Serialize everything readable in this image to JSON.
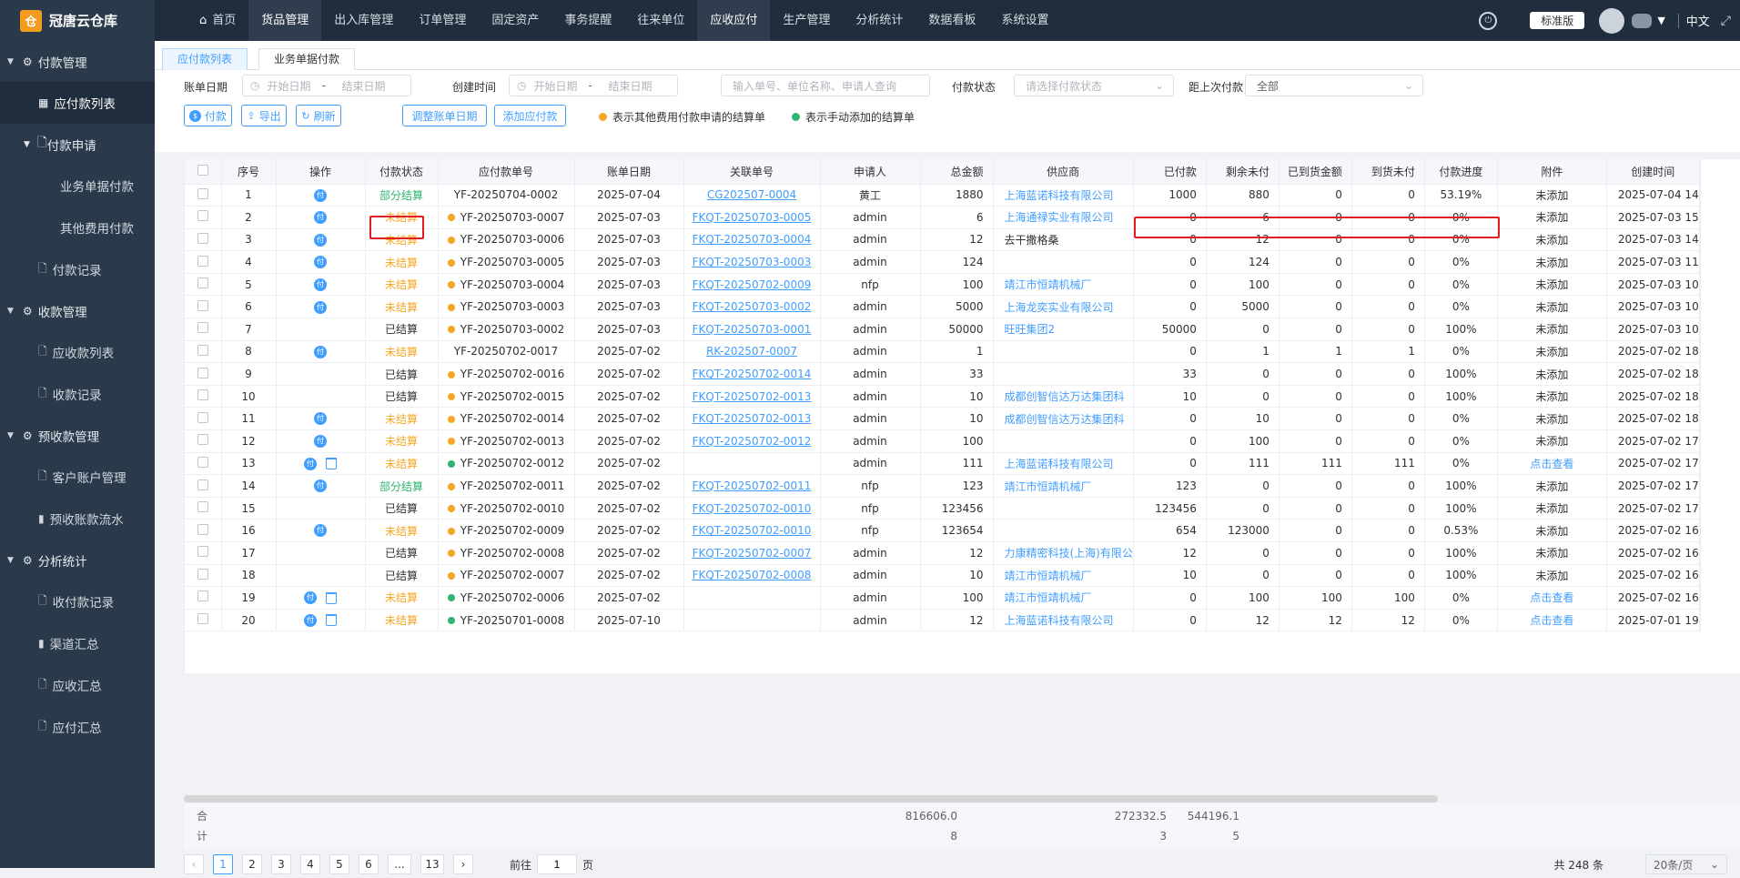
{
  "app": {
    "name": "冠唐云仓库",
    "logo_glyph": "仓"
  },
  "nav": [
    "首页",
    "货品管理",
    "出入库管理",
    "订单管理",
    "固定资产",
    "事务提醒",
    "往来单位",
    "应收应付",
    "生产管理",
    "分析统计",
    "数据看板",
    "系统设置"
  ],
  "topright": {
    "edition": "标准版",
    "lang": "中文"
  },
  "sidebar": {
    "g_pay": "付款管理",
    "payable_list": "应付款列表",
    "pay_request": "付款申请",
    "biz_pay": "业务单据付款",
    "other_pay": "其他费用付款",
    "pay_record": "付款记录",
    "g_receive": "收款管理",
    "receivable_list": "应收款列表",
    "receive_record": "收款记录",
    "g_prepay": "预收款管理",
    "cust_account": "客户账户管理",
    "prepay_flow": "预收账款流水",
    "g_analysis": "分析统计",
    "pay_receive_record": "收付款记录",
    "channel_sum": "渠道汇总",
    "receivable_sum": "应收汇总",
    "payable_sum": "应付汇总"
  },
  "tabs": [
    "应付款列表",
    "业务单据付款"
  ],
  "filters": {
    "bill_date": "账单日期",
    "create_time": "创建时间",
    "start_ph": "开始日期",
    "end_ph": "结束日期",
    "dash": "-",
    "search_ph": "输入单号、单位名称、申请人查询",
    "pay_status": "付款状态",
    "pay_status_ph": "请选择付款状态",
    "since_last": "距上次付款",
    "since_last_val": "全部"
  },
  "buttons": {
    "pay": "付款",
    "export": "导出",
    "refresh": "刷新",
    "adjust": "调整账单日期",
    "add": "添加应付款"
  },
  "legend": {
    "orange_text": "表示其他费用付款申请的结算单",
    "green_text": "表示手动添加的结算单",
    "orange": "#f5a623",
    "green": "#2fb56f"
  },
  "table": {
    "headers": [
      "序号",
      "操作",
      "付款状态",
      "应付款单号",
      "账单日期",
      "关联单号",
      "申请人",
      "总金额",
      "供应商",
      "已付款",
      "剩余未付",
      "已到货金额",
      "到货未付",
      "付款进度",
      "附件",
      "创建时间"
    ],
    "rows": [
      {
        "no": "1",
        "pay": true,
        "del": false,
        "status": "部分结算",
        "st": "part",
        "dot": "",
        "id": "YF-20250704-0002",
        "date": "2025-07-04",
        "ref": "CG202507-0004",
        "applicant": "黄工",
        "total": "1880",
        "supplier": "上海蓝诺科技有限公司",
        "paid": "1000",
        "remain": "880",
        "arrived": "0",
        "arr_unpaid": "0",
        "progress": "53.19%",
        "attach": "未添加",
        "attach_link": false,
        "created": "2025-07-04 14"
      },
      {
        "no": "2",
        "pay": true,
        "del": false,
        "status": "未结算",
        "st": "un",
        "dot": "orange",
        "id": "YF-20250703-0007",
        "date": "2025-07-03",
        "ref": "FKQT-20250703-0005",
        "applicant": "admin",
        "total": "6",
        "supplier": "上海通禄实业有限公司",
        "paid": "0",
        "remain": "6",
        "arrived": "0",
        "arr_unpaid": "0",
        "progress": "0%",
        "attach": "未添加",
        "attach_link": false,
        "created": "2025-07-03 15"
      },
      {
        "no": "3",
        "pay": true,
        "del": false,
        "status": "未结算",
        "st": "un",
        "dot": "orange",
        "id": "YF-20250703-0006",
        "date": "2025-07-03",
        "ref": "FKQT-20250703-0004",
        "applicant": "admin",
        "total": "12",
        "supplier": "去干撒格桑",
        "supplier_plain": true,
        "paid": "0",
        "remain": "12",
        "arrived": "0",
        "arr_unpaid": "0",
        "progress": "0%",
        "attach": "未添加",
        "attach_link": false,
        "created": "2025-07-03 14"
      },
      {
        "no": "4",
        "pay": true,
        "del": false,
        "status": "未结算",
        "st": "un",
        "dot": "orange",
        "id": "YF-20250703-0005",
        "date": "2025-07-03",
        "ref": "FKQT-20250703-0003",
        "applicant": "admin",
        "total": "124",
        "supplier": "",
        "paid": "0",
        "remain": "124",
        "arrived": "0",
        "arr_unpaid": "0",
        "progress": "0%",
        "attach": "未添加",
        "attach_link": false,
        "created": "2025-07-03 11"
      },
      {
        "no": "5",
        "pay": true,
        "del": false,
        "status": "未结算",
        "st": "un",
        "dot": "orange",
        "id": "YF-20250703-0004",
        "date": "2025-07-03",
        "ref": "FKQT-20250702-0009",
        "applicant": "nfp",
        "total": "100",
        "supplier": "靖江市恒靖机械厂",
        "paid": "0",
        "remain": "100",
        "arrived": "0",
        "arr_unpaid": "0",
        "progress": "0%",
        "attach": "未添加",
        "attach_link": false,
        "created": "2025-07-03 10"
      },
      {
        "no": "6",
        "pay": true,
        "del": false,
        "status": "未结算",
        "st": "un",
        "dot": "orange",
        "id": "YF-20250703-0003",
        "date": "2025-07-03",
        "ref": "FKQT-20250703-0002",
        "applicant": "admin",
        "total": "5000",
        "supplier": "上海龙奕实业有限公司",
        "paid": "0",
        "remain": "5000",
        "arrived": "0",
        "arr_unpaid": "0",
        "progress": "0%",
        "attach": "未添加",
        "attach_link": false,
        "created": "2025-07-03 10"
      },
      {
        "no": "7",
        "pay": false,
        "del": false,
        "status": "已结算",
        "st": "done",
        "dot": "orange",
        "id": "YF-20250703-0002",
        "date": "2025-07-03",
        "ref": "FKQT-20250703-0001",
        "applicant": "admin",
        "total": "50000",
        "supplier": "旺旺集团2",
        "paid": "50000",
        "remain": "0",
        "arrived": "0",
        "arr_unpaid": "0",
        "progress": "100%",
        "attach": "未添加",
        "attach_link": false,
        "created": "2025-07-03 10"
      },
      {
        "no": "8",
        "pay": true,
        "del": false,
        "status": "未结算",
        "st": "un",
        "dot": "",
        "id": "YF-20250702-0017",
        "date": "2025-07-02",
        "ref": "RK-202507-0007",
        "applicant": "admin",
        "total": "1",
        "supplier": "",
        "paid": "0",
        "remain": "1",
        "arrived": "1",
        "arr_unpaid": "1",
        "progress": "0%",
        "attach": "未添加",
        "attach_link": false,
        "created": "2025-07-02 18"
      },
      {
        "no": "9",
        "pay": false,
        "del": false,
        "status": "已结算",
        "st": "done",
        "dot": "orange",
        "id": "YF-20250702-0016",
        "date": "2025-07-02",
        "ref": "FKQT-20250702-0014",
        "applicant": "admin",
        "total": "33",
        "supplier": "",
        "paid": "33",
        "remain": "0",
        "arrived": "0",
        "arr_unpaid": "0",
        "progress": "100%",
        "attach": "未添加",
        "attach_link": false,
        "created": "2025-07-02 18"
      },
      {
        "no": "10",
        "pay": false,
        "del": false,
        "status": "已结算",
        "st": "done",
        "dot": "orange",
        "id": "YF-20250702-0015",
        "date": "2025-07-02",
        "ref": "FKQT-20250702-0013",
        "applicant": "admin",
        "total": "10",
        "supplier": "成都创智信达万达集团科",
        "paid": "10",
        "remain": "0",
        "arrived": "0",
        "arr_unpaid": "0",
        "progress": "100%",
        "attach": "未添加",
        "attach_link": false,
        "created": "2025-07-02 18"
      },
      {
        "no": "11",
        "pay": true,
        "del": false,
        "status": "未结算",
        "st": "un",
        "dot": "orange",
        "id": "YF-20250702-0014",
        "date": "2025-07-02",
        "ref": "FKQT-20250702-0013",
        "applicant": "admin",
        "total": "10",
        "supplier": "成都创智信达万达集团科",
        "paid": "0",
        "remain": "10",
        "arrived": "0",
        "arr_unpaid": "0",
        "progress": "0%",
        "attach": "未添加",
        "attach_link": false,
        "created": "2025-07-02 18"
      },
      {
        "no": "12",
        "pay": true,
        "del": false,
        "status": "未结算",
        "st": "un",
        "dot": "orange",
        "id": "YF-20250702-0013",
        "date": "2025-07-02",
        "ref": "FKQT-20250702-0012",
        "applicant": "admin",
        "total": "100",
        "supplier": "",
        "paid": "0",
        "remain": "100",
        "arrived": "0",
        "arr_unpaid": "0",
        "progress": "0%",
        "attach": "未添加",
        "attach_link": false,
        "created": "2025-07-02 17"
      },
      {
        "no": "13",
        "pay": true,
        "del": true,
        "status": "未结算",
        "st": "un",
        "dot": "green",
        "id": "YF-20250702-0012",
        "date": "2025-07-02",
        "ref": "",
        "applicant": "admin",
        "total": "111",
        "supplier": "上海蓝诺科技有限公司",
        "paid": "0",
        "remain": "111",
        "arrived": "111",
        "arr_unpaid": "111",
        "progress": "0%",
        "attach": "点击查看",
        "attach_link": true,
        "created": "2025-07-02 17"
      },
      {
        "no": "14",
        "pay": true,
        "del": false,
        "status": "部分结算",
        "st": "part",
        "dot": "orange",
        "id": "YF-20250702-0011",
        "date": "2025-07-02",
        "ref": "FKQT-20250702-0011",
        "applicant": "nfp",
        "total": "123",
        "supplier": "靖江市恒靖机械厂",
        "paid": "123",
        "remain": "0",
        "arrived": "0",
        "arr_unpaid": "0",
        "progress": "100%",
        "attach": "未添加",
        "attach_link": false,
        "created": "2025-07-02 17"
      },
      {
        "no": "15",
        "pay": false,
        "del": false,
        "status": "已结算",
        "st": "done",
        "dot": "orange",
        "id": "YF-20250702-0010",
        "date": "2025-07-02",
        "ref": "FKQT-20250702-0010",
        "applicant": "nfp",
        "total": "123456",
        "supplier": "",
        "paid": "123456",
        "remain": "0",
        "arrived": "0",
        "arr_unpaid": "0",
        "progress": "100%",
        "attach": "未添加",
        "attach_link": false,
        "created": "2025-07-02 17"
      },
      {
        "no": "16",
        "pay": true,
        "del": false,
        "status": "未结算",
        "st": "un",
        "dot": "orange",
        "id": "YF-20250702-0009",
        "date": "2025-07-02",
        "ref": "FKQT-20250702-0010",
        "applicant": "nfp",
        "total": "123654",
        "supplier": "",
        "paid": "654",
        "remain": "123000",
        "arrived": "0",
        "arr_unpaid": "0",
        "progress": "0.53%",
        "attach": "未添加",
        "attach_link": false,
        "created": "2025-07-02 16"
      },
      {
        "no": "17",
        "pay": false,
        "del": false,
        "status": "已结算",
        "st": "done",
        "dot": "orange",
        "id": "YF-20250702-0008",
        "date": "2025-07-02",
        "ref": "FKQT-20250702-0007",
        "applicant": "admin",
        "total": "12",
        "supplier": "力康精密科技(上海)有限公",
        "paid": "12",
        "remain": "0",
        "arrived": "0",
        "arr_unpaid": "0",
        "progress": "100%",
        "attach": "未添加",
        "attach_link": false,
        "created": "2025-07-02 16"
      },
      {
        "no": "18",
        "pay": false,
        "del": false,
        "status": "已结算",
        "st": "done",
        "dot": "orange",
        "id": "YF-20250702-0007",
        "date": "2025-07-02",
        "ref": "FKQT-20250702-0008",
        "applicant": "admin",
        "total": "10",
        "supplier": "靖江市恒靖机械厂",
        "paid": "10",
        "remain": "0",
        "arrived": "0",
        "arr_unpaid": "0",
        "progress": "100%",
        "attach": "未添加",
        "attach_link": false,
        "created": "2025-07-02 16"
      },
      {
        "no": "19",
        "pay": true,
        "del": true,
        "status": "未结算",
        "st": "un",
        "dot": "green",
        "id": "YF-20250702-0006",
        "date": "2025-07-02",
        "ref": "",
        "applicant": "admin",
        "total": "100",
        "supplier": "靖江市恒靖机械厂",
        "paid": "0",
        "remain": "100",
        "arrived": "100",
        "arr_unpaid": "100",
        "progress": "0%",
        "attach": "点击查看",
        "attach_link": true,
        "created": "2025-07-02 16"
      },
      {
        "no": "20",
        "pay": true,
        "del": true,
        "status": "未结算",
        "st": "un",
        "dot": "green",
        "id": "YF-20250701-0008",
        "date": "2025-07-10",
        "ref": "",
        "applicant": "admin",
        "total": "12",
        "supplier": "上海蓝诺科技有限公司",
        "paid": "0",
        "remain": "12",
        "arrived": "12",
        "arr_unpaid": "12",
        "progress": "0%",
        "attach": "点击查看",
        "attach_link": true,
        "created": "2025-07-01 19"
      }
    ],
    "pay_glyph": "付",
    "summary": {
      "label_1": "合",
      "label_2": "计",
      "total_1": "816606.0",
      "total_2": "8",
      "paid_1": "272332.5",
      "paid_2": "3",
      "remain_1": "544196.1",
      "remain_2": "5"
    }
  },
  "pager": {
    "pages": [
      "1",
      "2",
      "3",
      "4",
      "5",
      "6",
      "...",
      "13"
    ],
    "current": "1",
    "goto_prefix": "前往",
    "goto_value": "1",
    "goto_suffix": "页",
    "total": "共 248 条",
    "page_size": "20条/页"
  }
}
